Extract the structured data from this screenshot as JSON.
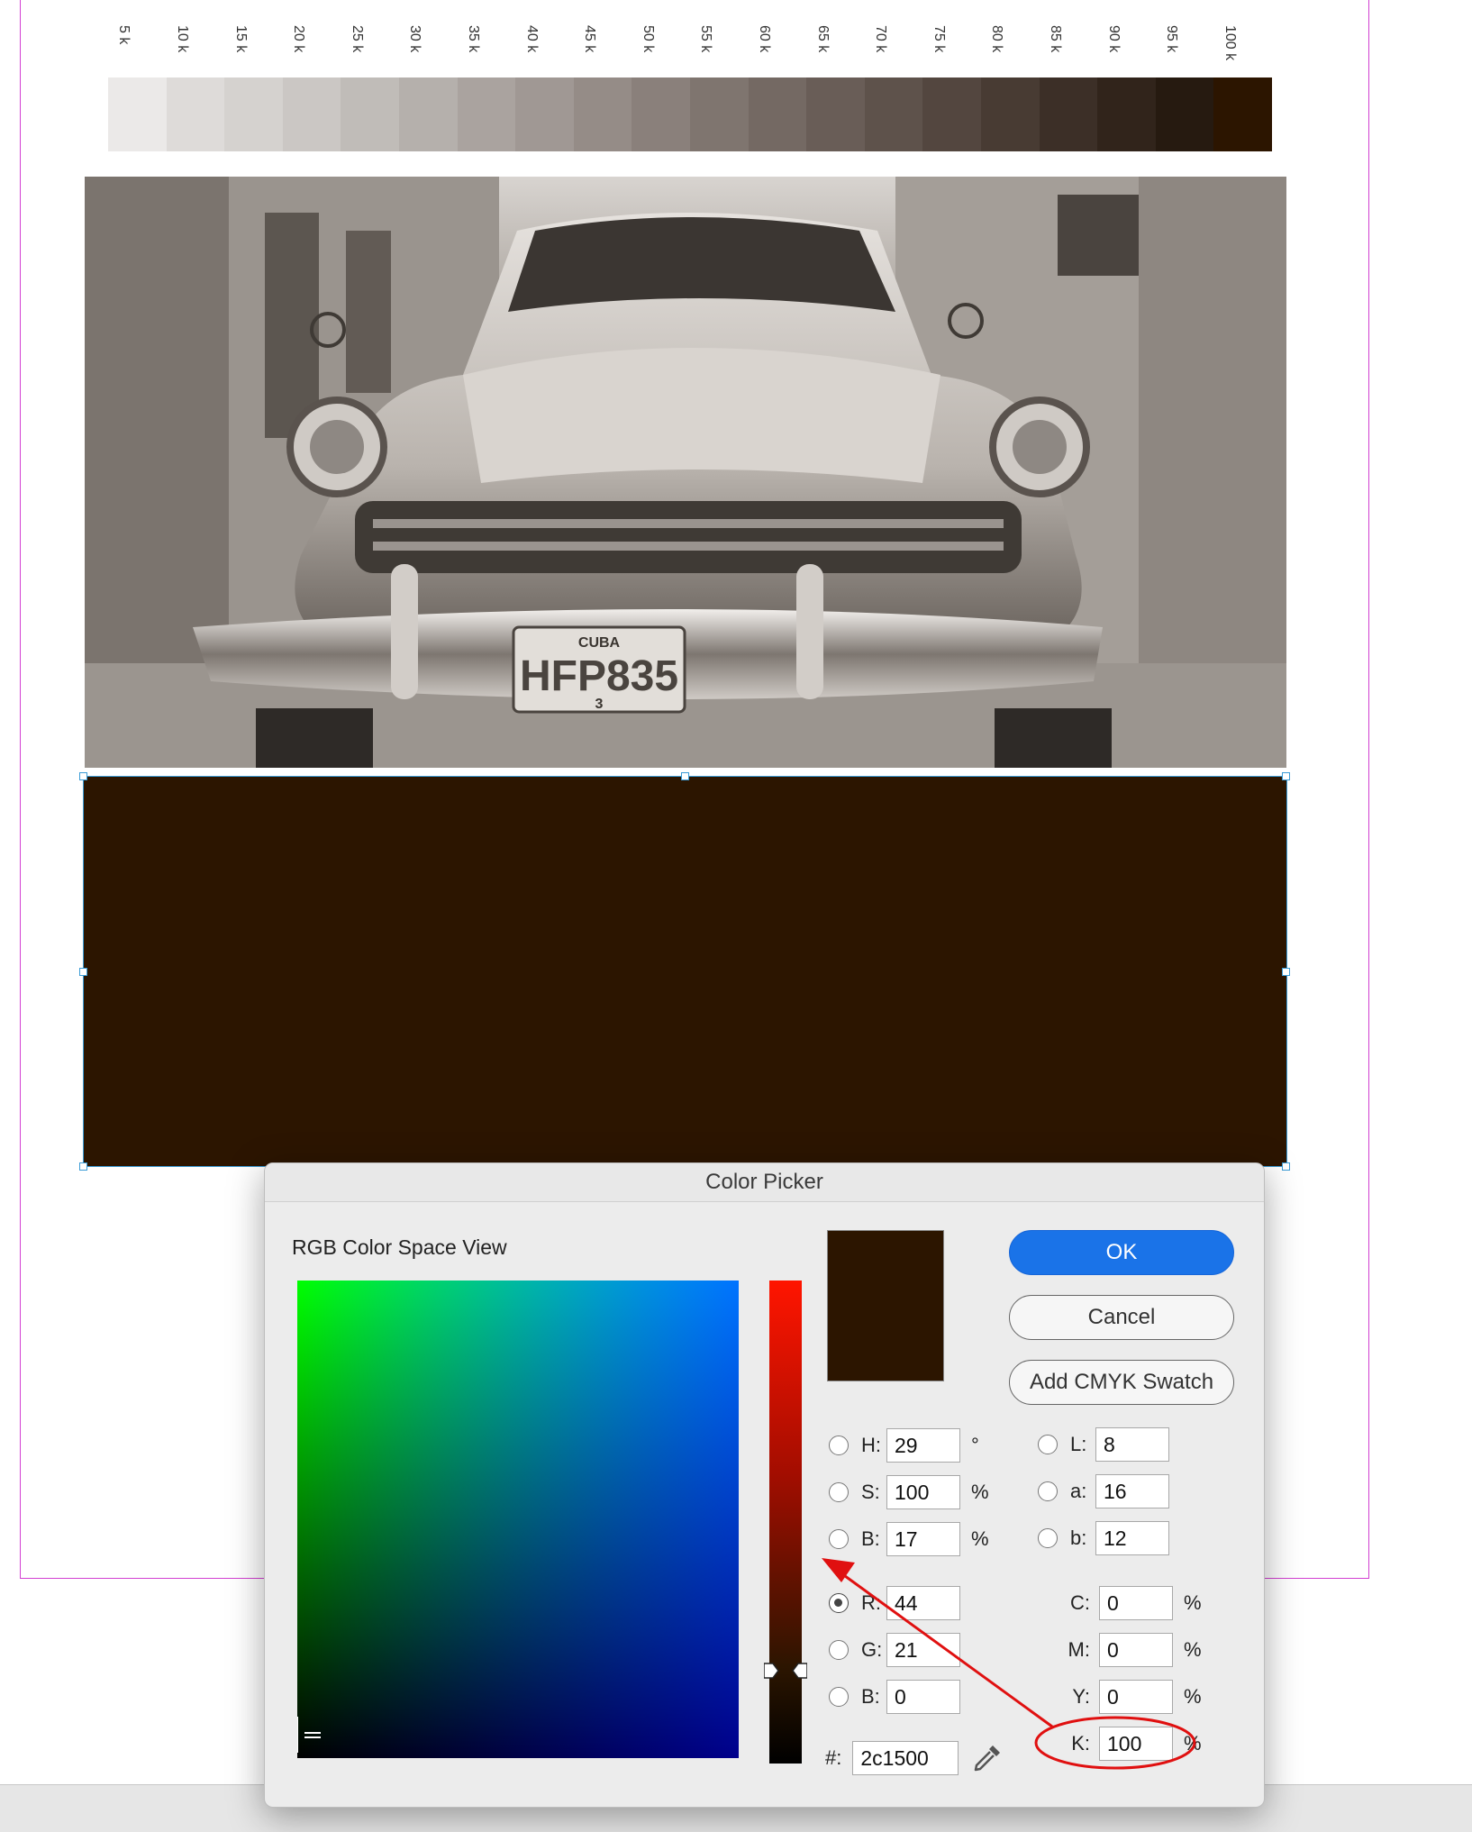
{
  "document": {
    "tone_ramp": {
      "labels": [
        "5 k",
        "10 k",
        "15 k",
        "20 k",
        "25 k",
        "30 k",
        "35 k",
        "40 k",
        "45 k",
        "50 k",
        "55 k",
        "60 k",
        "65 k",
        "70 k",
        "75 k",
        "80 k",
        "85 k",
        "90 k",
        "95 k",
        "100 k"
      ],
      "colors": [
        "#ebe9e8",
        "#dedbd9",
        "#d5d2cf",
        "#cbc7c4",
        "#c0bcb8",
        "#b5b0ac",
        "#aaa39f",
        "#a09894",
        "#958c87",
        "#8a807b",
        "#7f756f",
        "#746963",
        "#695d57",
        "#5e524b",
        "#53463f",
        "#483b33",
        "#3c2f27",
        "#31241b",
        "#261a10",
        "#2c1500"
      ]
    },
    "photo": {
      "plate_top": "CUBA",
      "plate_main": "HFP835",
      "plate_bottom": "3"
    },
    "filled_frame_color": "#2c1500"
  },
  "color_picker": {
    "title": "Color Picker",
    "view_label": "RGB Color Space View",
    "preview_color": "#2c1500",
    "buttons": {
      "ok": "OK",
      "cancel": "Cancel",
      "add_swatch": "Add CMYK Swatch"
    },
    "hsb": [
      {
        "label": "H:",
        "value": "29",
        "unit": "°",
        "selected": false
      },
      {
        "label": "S:",
        "value": "100",
        "unit": "%",
        "selected": false
      },
      {
        "label": "B:",
        "value": "17",
        "unit": "%",
        "selected": false
      }
    ],
    "rgb": [
      {
        "label": "R:",
        "value": "44",
        "selected": true
      },
      {
        "label": "G:",
        "value": "21",
        "selected": false
      },
      {
        "label": "B:",
        "value": "0",
        "selected": false
      }
    ],
    "lab": [
      {
        "label": "L:",
        "value": "8",
        "selected": false
      },
      {
        "label": "a:",
        "value": "16",
        "selected": false
      },
      {
        "label": "b:",
        "value": "12",
        "selected": false
      }
    ],
    "cmyk": [
      {
        "label": "C:",
        "value": "0",
        "unit": "%"
      },
      {
        "label": "M:",
        "value": "0",
        "unit": "%"
      },
      {
        "label": "Y:",
        "value": "0",
        "unit": "%"
      },
      {
        "label": "K:",
        "value": "100",
        "unit": "%"
      }
    ],
    "hex": {
      "label": "#:",
      "value": "2c1500"
    },
    "annotation_color": "#e01010"
  }
}
